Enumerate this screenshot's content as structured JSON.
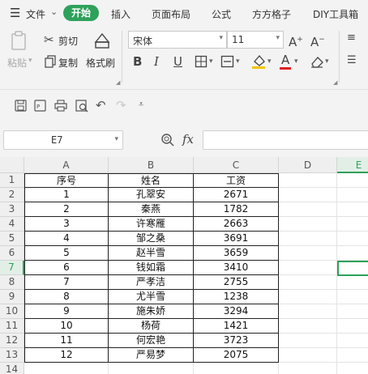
{
  "menubar": {
    "file_label": "文件",
    "tabs": [
      "开始",
      "插入",
      "页面布局",
      "公式",
      "方方格子",
      "DIY工具箱"
    ]
  },
  "ribbon": {
    "paste_label": "粘贴",
    "cut_label": "剪切",
    "copy_label": "复制",
    "format_painter_label": "格式刷",
    "font_name": "宋体",
    "font_size": "11",
    "accent_color": "#2ea15a",
    "font_color_bar": "#e02020",
    "highlight_color_bar": "#f5c400"
  },
  "formula_bar": {
    "name_box": "E7",
    "fx_label": "fx",
    "formula": ""
  },
  "sheet": {
    "columns": [
      "A",
      "B",
      "C",
      "D",
      "E"
    ],
    "rows": [
      "1",
      "2",
      "3",
      "4",
      "5",
      "6",
      "7",
      "8",
      "9",
      "10",
      "11",
      "12",
      "13",
      "14"
    ],
    "selected_cell": "E7",
    "headers": [
      "序号",
      "姓名",
      "工资"
    ],
    "data": [
      [
        "1",
        "孔翠安",
        "2671"
      ],
      [
        "2",
        "秦燕",
        "1782"
      ],
      [
        "3",
        "许寒雁",
        "2663"
      ],
      [
        "4",
        "邹之桑",
        "3691"
      ],
      [
        "5",
        "赵半雪",
        "3659"
      ],
      [
        "6",
        "钱如霜",
        "3410"
      ],
      [
        "7",
        "严孝洁",
        "2755"
      ],
      [
        "8",
        "尤半雪",
        "1238"
      ],
      [
        "9",
        "施朱娇",
        "3294"
      ],
      [
        "10",
        "杨荷",
        "1421"
      ],
      [
        "11",
        "何宏艳",
        "3723"
      ],
      [
        "12",
        "严易梦",
        "2075"
      ]
    ]
  }
}
